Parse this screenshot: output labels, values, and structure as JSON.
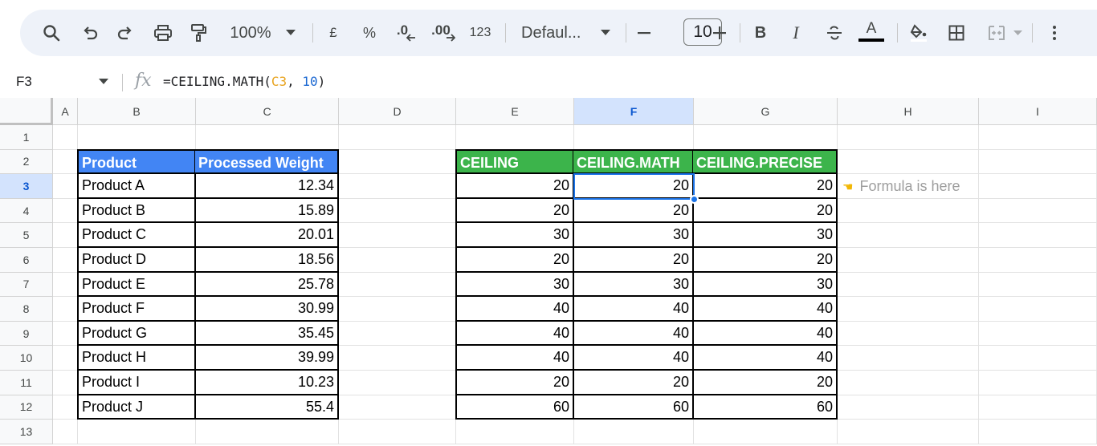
{
  "toolbar": {
    "zoom": "100%",
    "currency": "£",
    "percent": "%",
    "decrease_decimal": ".0",
    "increase_decimal": ".00",
    "number_format": "123",
    "font": "Defaul...",
    "font_size": "10",
    "bold": "B",
    "italic": "I",
    "text_color_glyph": "A",
    "text_color": "#000000"
  },
  "formula_bar": {
    "name_box": "F3",
    "fx": "fx",
    "formula_prefix": "=CEILING.MATH(",
    "formula_ref": "C3",
    "formula_sep": ", ",
    "formula_arg": "10",
    "formula_suffix": ")"
  },
  "columns": [
    "A",
    "B",
    "C",
    "D",
    "E",
    "F",
    "G",
    "H",
    "I"
  ],
  "rows": [
    "1",
    "2",
    "3",
    "4",
    "5",
    "6",
    "7",
    "8",
    "9",
    "10",
    "11",
    "12",
    "13"
  ],
  "selected_cell": "F3",
  "table_left": {
    "headers": [
      "Product",
      "Processed Weight"
    ],
    "rows": [
      [
        "Product A",
        "12.34"
      ],
      [
        "Product B",
        "15.89"
      ],
      [
        "Product C",
        "20.01"
      ],
      [
        "Product D",
        "18.56"
      ],
      [
        "Product E",
        "25.78"
      ],
      [
        "Product F",
        "30.99"
      ],
      [
        "Product G",
        "35.45"
      ],
      [
        "Product H",
        "39.99"
      ],
      [
        "Product I",
        "10.23"
      ],
      [
        "Product J",
        "55.4"
      ]
    ]
  },
  "table_right": {
    "headers": [
      "CEILING",
      "CEILING.MATH",
      "CEILING.PRECISE"
    ],
    "rows": [
      [
        "20",
        "20",
        "20"
      ],
      [
        "20",
        "20",
        "20"
      ],
      [
        "30",
        "30",
        "30"
      ],
      [
        "20",
        "20",
        "20"
      ],
      [
        "30",
        "30",
        "30"
      ],
      [
        "40",
        "40",
        "40"
      ],
      [
        "40",
        "40",
        "40"
      ],
      [
        "40",
        "40",
        "40"
      ],
      [
        "20",
        "20",
        "20"
      ],
      [
        "60",
        "60",
        "60"
      ]
    ]
  },
  "note": "Formula is here",
  "colors": {
    "header_blue": "#4285f4",
    "header_green": "#3cb44b",
    "selection": "#1a73e8"
  }
}
